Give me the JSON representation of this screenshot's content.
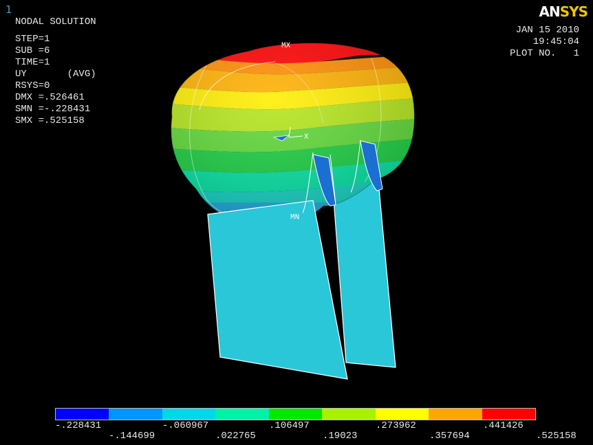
{
  "window": {
    "number": "1"
  },
  "logo": {
    "an": "AN",
    "sys": "SYS"
  },
  "info": {
    "title": "NODAL SOLUTION",
    "lines": [
      "STEP=1",
      "SUB =6",
      "TIME=1",
      "UY       (AVG)",
      "RSYS=0",
      "DMX =.526461",
      "SMN =-.228431",
      "SMX =.525158"
    ]
  },
  "plot_info": {
    "date": "JAN 15 2010",
    "time": "19:45:04",
    "plot_no": "PLOT NO.   1"
  },
  "model_labels": {
    "max": "MX",
    "min": "MN",
    "axis_x": "X"
  },
  "legend": {
    "colors": [
      "#0000ff",
      "#0095ff",
      "#00d8e8",
      "#00f2a8",
      "#00e800",
      "#a8f200",
      "#ffff00",
      "#ffa500",
      "#ff0000"
    ],
    "top_values": [
      "-.228431",
      "-.060967",
      ".106497",
      ".273962",
      ".441426"
    ],
    "bottom_values": [
      "-.144699",
      ".022765",
      ".19023",
      ".357694",
      ".525158"
    ]
  }
}
